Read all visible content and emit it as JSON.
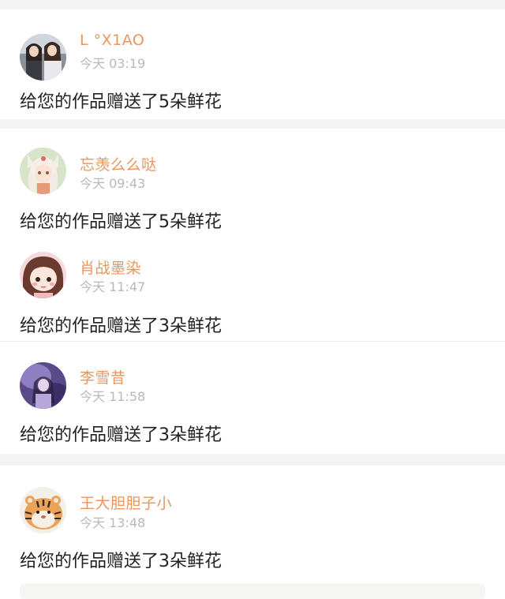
{
  "feed": [
    {
      "name": "L °X1AO",
      "time": "今天 03:19",
      "message": "给您的作品赠送了5朵鲜花",
      "avatar_icon": "two-girls-photo-avatar"
    },
    {
      "name": "忘羡么么哒",
      "time": "今天 09:43",
      "message": "给您的作品赠送了5朵鲜花",
      "avatar_icon": "anime-fox-girl-avatar"
    },
    {
      "name": "肖战墨染",
      "time": "今天 11:47",
      "message": "给您的作品赠送了3朵鲜花",
      "avatar_icon": "cartoon-girl-avatar"
    },
    {
      "name": "李雪昔",
      "time": "今天 11:58",
      "message": "给您的作品赠送了3朵鲜花",
      "avatar_icon": "purple-photo-avatar"
    },
    {
      "name": "王大胆胆子小",
      "time": "今天 13:48",
      "message": "给您的作品赠送了3朵鲜花",
      "avatar_icon": "chubby-tiger-avatar"
    }
  ],
  "colors": {
    "name": "#e9965f",
    "time": "#b9b9b9",
    "message": "#222222",
    "separator": "#f4f4f4"
  }
}
